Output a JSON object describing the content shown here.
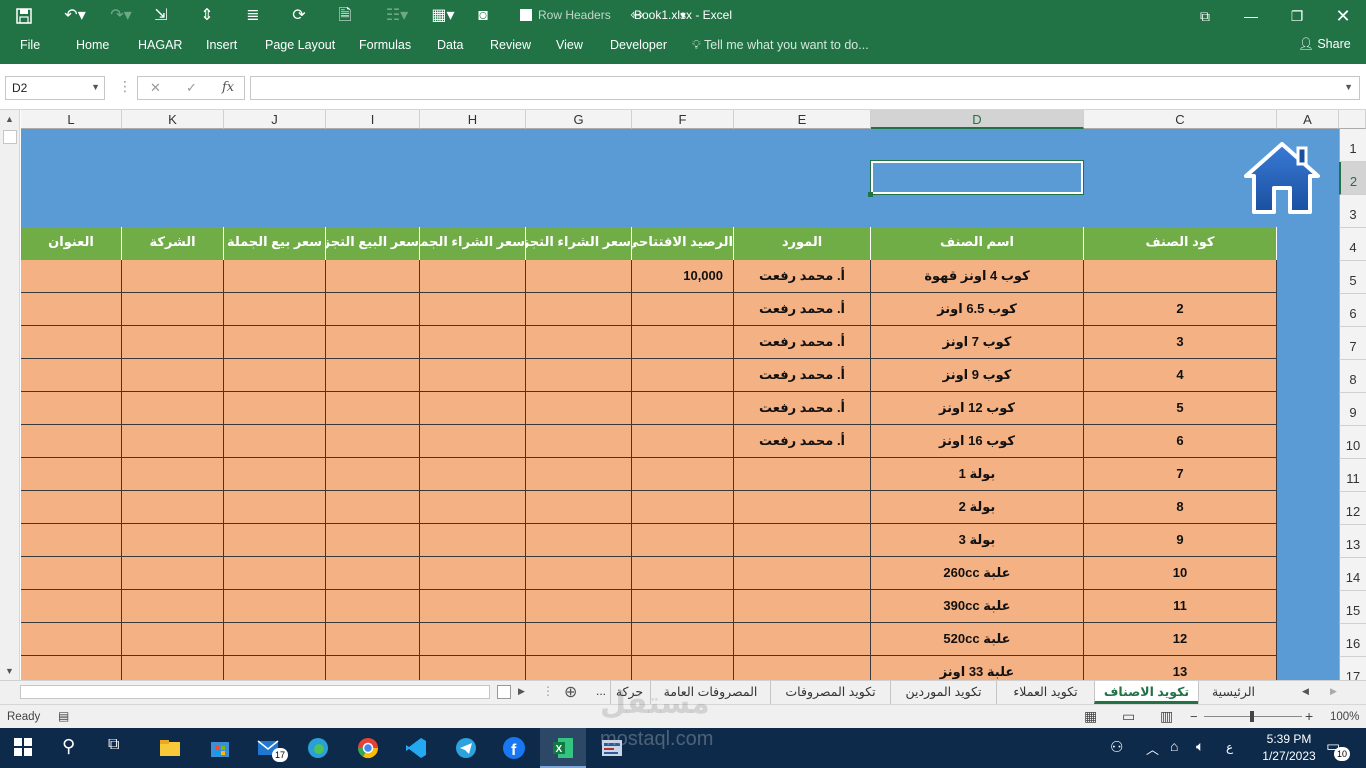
{
  "app": {
    "title": "Book1.xlsx  -  Excel",
    "row_headers_label": "Row Headers",
    "tabs": [
      "File",
      "Home",
      "HAGAR",
      "Insert",
      "Page Layout",
      "Formulas",
      "Data",
      "Review",
      "View",
      "Developer"
    ],
    "tell_me": "Tell me what you want to do...",
    "share": "Share"
  },
  "formula_bar": {
    "name_box": "D2",
    "fx_label": "fx",
    "formula": ""
  },
  "columns": [
    "L",
    "K",
    "J",
    "I",
    "H",
    "G",
    "F",
    "E",
    "D",
    "C",
    "A"
  ],
  "rows": [
    "1",
    "2",
    "3",
    "4",
    "5",
    "6",
    "7",
    "8",
    "9",
    "10",
    "11",
    "12",
    "13",
    "14",
    "15",
    "16",
    "17"
  ],
  "table": {
    "headers": [
      "العنوان",
      "الشركة",
      "سعر بيع الجملة",
      "سعر البيع التجزئة",
      "سعر الشراء الجملة",
      "سعر الشراء التجزئة",
      "الرصيد الافتتاحي",
      "المورد",
      "اسم الصنف",
      "كود الصنف"
    ],
    "rows": [
      [
        "",
        "",
        "",
        "",
        "",
        "",
        "10,000",
        "أ. محمد رفعت",
        "كوب 4 اونز قهوة",
        ""
      ],
      [
        "",
        "",
        "",
        "",
        "",
        "",
        "",
        "أ. محمد رفعت",
        "كوب 6.5 اونز",
        "2"
      ],
      [
        "",
        "",
        "",
        "",
        "",
        "",
        "",
        "أ. محمد رفعت",
        "كوب 7 اونز",
        "3"
      ],
      [
        "",
        "",
        "",
        "",
        "",
        "",
        "",
        "أ. محمد رفعت",
        "كوب 9 اونز",
        "4"
      ],
      [
        "",
        "",
        "",
        "",
        "",
        "",
        "",
        "أ. محمد رفعت",
        "كوب 12 اونز",
        "5"
      ],
      [
        "",
        "",
        "",
        "",
        "",
        "",
        "",
        "أ. محمد رفعت",
        "كوب 16 اونز",
        "6"
      ],
      [
        "",
        "",
        "",
        "",
        "",
        "",
        "",
        "",
        "بولة 1",
        "7"
      ],
      [
        "",
        "",
        "",
        "",
        "",
        "",
        "",
        "",
        "بولة 2",
        "8"
      ],
      [
        "",
        "",
        "",
        "",
        "",
        "",
        "",
        "",
        "بولة 3",
        "9"
      ],
      [
        "",
        "",
        "",
        "",
        "",
        "",
        "",
        "",
        "علبة 260cc",
        "10"
      ],
      [
        "",
        "",
        "",
        "",
        "",
        "",
        "",
        "",
        "علبة 390cc",
        "11"
      ],
      [
        "",
        "",
        "",
        "",
        "",
        "",
        "",
        "",
        "علبة 520cc",
        "12"
      ],
      [
        "",
        "",
        "",
        "",
        "",
        "",
        "",
        "",
        "علبة 33 اونز",
        "13"
      ]
    ]
  },
  "sheet_tabs": [
    "الرئيسية",
    "تكويد الاصناف",
    "تكويد العملاء",
    "تكويد الموردين",
    "تكويد المصروفات",
    "المصروفات العامة",
    "حركة ..."
  ],
  "active_sheet": "تكويد الاصناف",
  "status": {
    "ready": "Ready",
    "zoom": "100%"
  },
  "taskbar": {
    "time": "5:39 PM",
    "date": "1/27/2023",
    "mail_badge": "17",
    "notif_badge": "10",
    "lang": "ع"
  },
  "watermark": {
    "brand_ar": "مستقل",
    "brand_url": "mostaql.com"
  },
  "colors": {
    "excel_green": "#217346",
    "header_green": "#70ad47",
    "cell_orange": "#f4b183",
    "band_blue": "#5b9bd5"
  }
}
